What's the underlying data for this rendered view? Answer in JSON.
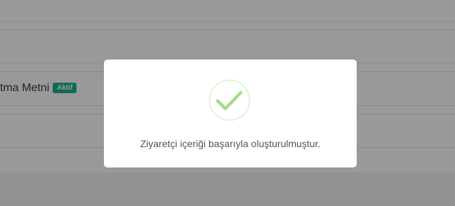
{
  "background": {
    "row_label": "tma Metni",
    "status_badge": "Aktif"
  },
  "modal": {
    "icon": "check-icon",
    "message": "Ziyaretçi içeriği başarıyla oluşturulmuştur."
  },
  "colors": {
    "badge": "#1fb18b",
    "success": "#a5dc86",
    "overlay": "rgba(0,0,0,0.4)"
  }
}
